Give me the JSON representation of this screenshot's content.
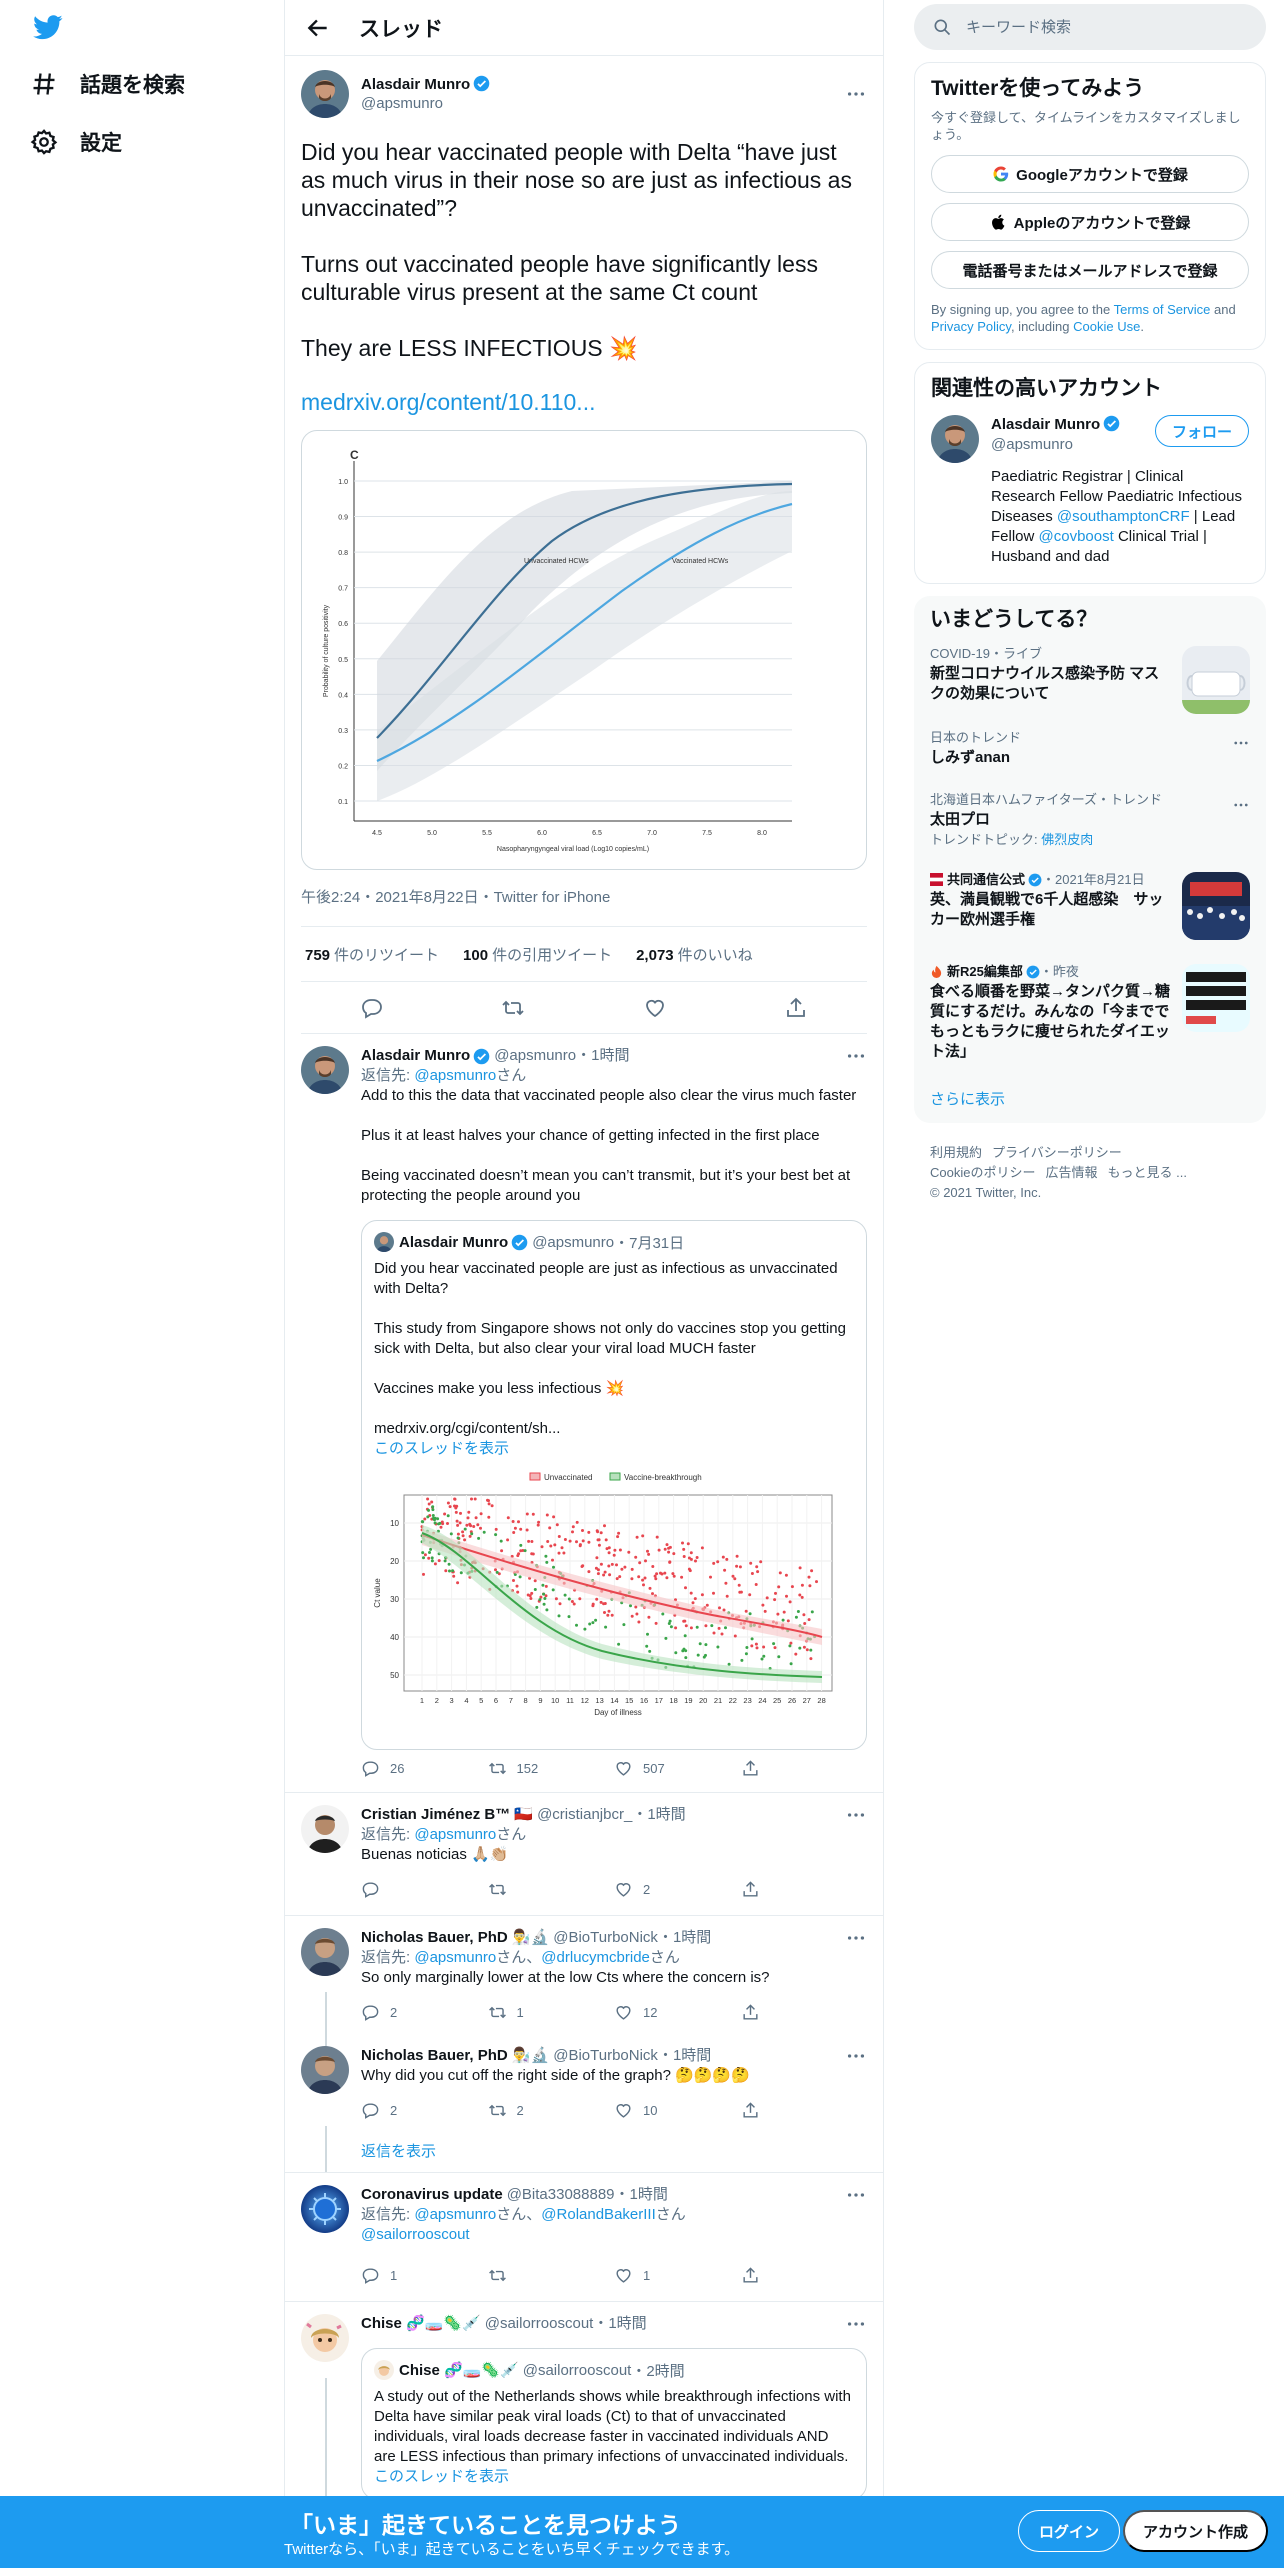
{
  "nav": {
    "explore": "話題を検索",
    "settings": "設定"
  },
  "header": {
    "title": "スレッド"
  },
  "focal": {
    "name": "Alasdair Munro",
    "handle": "@apsmunro",
    "text1": "Did you hear vaccinated people with Delta “have just as much virus in their nose so are just as infectious as unvaccinated”?",
    "text2": "Turns out vaccinated people have significantly less culturable virus present at the same Ct count",
    "text3": "They are LESS INFECTIOUS 💥",
    "link": "medrxiv.org/content/10.110...",
    "meta": "午後2:24・2021年8月22日・Twitter for iPhone",
    "retweets_count": "759",
    "retweets_label": "件のリツイート",
    "quotes_count": "100",
    "quotes_label": "件の引用ツイート",
    "likes_count": "2,073",
    "likes_label": "件のいいね"
  },
  "chart_data": [
    {
      "type": "line",
      "panel_label": "C",
      "xlabel": "Nasopharyngyngeal viral load (Log10 copies/mL)",
      "ylabel": "Probability of culture positivity",
      "x_ticks": [
        "4.5",
        "5.0",
        "5.5",
        "6.0",
        "6.5",
        "7.0",
        "7.5",
        "8.0"
      ],
      "y_ticks": [
        "0.1",
        "0.2",
        "0.3",
        "0.4",
        "0.5",
        "0.6",
        "0.7",
        "0.8",
        "0.9",
        "1.0"
      ],
      "series": [
        {
          "name": "Unvaccinated HCWs"
        },
        {
          "name": "Vaccinated HCWs"
        }
      ]
    },
    {
      "type": "scatter",
      "ylabel": "Ct value",
      "xlabel": "Day of illness",
      "y_ticks": [
        "10",
        "20",
        "30",
        "40",
        "50"
      ],
      "x_ticks": [
        "1",
        "2",
        "3",
        "4",
        "5",
        "6",
        "7",
        "8",
        "9",
        "10",
        "11",
        "12",
        "13",
        "14",
        "15",
        "16",
        "17",
        "18",
        "19",
        "20",
        "21",
        "22",
        "23",
        "24",
        "25",
        "26",
        "27",
        "28"
      ],
      "legend": [
        "Unvaccinated",
        "Vaccine-breakthrough"
      ],
      "colors": {
        "unvaccinated": "#e8464f",
        "breakthrough": "#3aa54a"
      }
    }
  ],
  "replies": [
    {
      "name": "Alasdair Munro",
      "handle": "@apsmunro",
      "time": "・1時間",
      "replyto_prefix": "返信先: ",
      "replyto_user": "@apsmunro",
      "replyto_suffix": "さん",
      "p1": "Add to this the data that vaccinated people also clear the virus much faster",
      "p2": "Plus it at least halves your chance of getting infected in the first place",
      "p3": "Being vaccinated doesn’t mean you can’t transmit, but it’s your best bet at protecting the people around you",
      "quote": {
        "name": "Alasdair Munro",
        "handle": "@apsmunro",
        "time": "・7月31日",
        "p1": "Did you hear vaccinated people are just as infectious as unvaccinated with Delta?",
        "p2": "This study from Singapore shows not only do vaccines stop you getting sick with Delta, but also clear your viral load MUCH faster",
        "p3": "Vaccines make you less infectious 💥",
        "p4": "medrxiv.org/cgi/content/sh...",
        "show": "このスレッドを表示"
      },
      "replies": "26",
      "retweets": "152",
      "likes": "507"
    },
    {
      "name": "Cristian Jiménez B™ 🇨🇱",
      "handle": "@cristianjbcr_",
      "time": "・1時間",
      "replyto_prefix": "返信先: ",
      "replyto_user": "@apsmunro",
      "replyto_suffix": "さん",
      "text": "Buenas noticias 🙏🏼👏🏼",
      "replies": "",
      "retweets": "",
      "likes": "2"
    },
    {
      "name": "Nicholas Bauer, PhD 👨‍🔬🔬",
      "handle": "@BioTurboNick",
      "time": "・1時間",
      "replyto_prefix": "返信先: ",
      "replyto_user": "@apsmunro",
      "replyto_mid": "さん、",
      "replyto_user2": "@drlucymcbride",
      "replyto_suffix": "さん",
      "text": "So only marginally lower at the low Cts where the concern is?",
      "replies": "2",
      "retweets": "1",
      "likes": "12"
    },
    {
      "name": "Nicholas Bauer, PhD 👨‍🔬🔬",
      "handle": "@BioTurboNick",
      "time": "・1時間",
      "text": "Why did you cut off the right side of the graph? 🤔🤔🤔🤔",
      "replies": "2",
      "retweets": "2",
      "likes": "10",
      "show_replies": "返信を表示"
    },
    {
      "name": "Coronavirus update",
      "handle": "@Bita33088889",
      "time": "・1時間",
      "replyto_prefix": "返信先: ",
      "replyto_user": "@apsmunro",
      "replyto_mid": "さん、",
      "replyto_user2": "@RolandBakerIII",
      "replyto_suffix": "さん",
      "replyto_user3": "@sailorrooscout",
      "replies": "1",
      "retweets": "",
      "likes": "1"
    },
    {
      "name": "Chise 🧬🧫🦠💉",
      "handle": "@sailorrooscout",
      "time": "・1時間",
      "quote": {
        "name": "Chise 🧬🧫🦠💉",
        "handle": "@sailorrooscout",
        "time": "・2時間",
        "text": "A study out of the Netherlands shows while breakthrough infections with Delta have similar peak viral loads (Ct) to that of unvaccinated individuals, viral loads decrease faster in vaccinated individuals AND are LESS infectious than primary infections of unvaccinated individuals.",
        "show": "このスレッドを表示"
      }
    }
  ],
  "right": {
    "search_placeholder": "キーワード検索",
    "signup_title": "Twitterを使ってみよう",
    "signup_sub": "今すぐ登録して、タイムラインをカスタマイズしましょう。",
    "google_btn": "Googleアカウントで登録",
    "apple_btn": "Appleのアカウントで登録",
    "phone_btn": "電話番号またはメールアドレスで登録",
    "terms_a": "By signing up, you agree to the ",
    "terms_tos": "Terms of Service",
    "terms_b": " and ",
    "terms_pp": "Privacy Policy",
    "terms_c": ", including ",
    "terms_cookie": "Cookie Use",
    "terms_d": ".",
    "related_title": "関連性の高いアカウント",
    "related_name": "Alasdair Munro",
    "related_handle": "@apsmunro",
    "follow": "フォロー",
    "bio_a": "Paediatric Registrar | Clinical Research Fellow Paediatric Infectious Diseases ",
    "bio_l1": "@southamptonCRF",
    "bio_b": " | Lead Fellow ",
    "bio_l2": "@covboost",
    "bio_c": " Clinical Trial | Husband and dad",
    "trends_title": "いまどうしてる？",
    "trends": [
      {
        "ctx": "COVID-19・ライブ",
        "title": "新型コロナウイルス感染予防 マスクの効果について"
      },
      {
        "ctx": "日本のトレンド",
        "title": "しみずanan"
      },
      {
        "ctx": "北海道日本ハムファイターズ・トレンド",
        "title": "太田プロ",
        "topic_label": "トレンドトピック: ",
        "topic": "佛烈皮肉"
      },
      {
        "ctx": "共同通信公式",
        "ctx_time": "・2021年8月21日",
        "title": "英、満員観戦で6千人超感染　サッカー欧州選手権"
      },
      {
        "ctx": "新R25編集部",
        "ctx_time": "・昨夜",
        "title": "食べる順番を野菜→タンパク質→糖質にするだけ。みんなの「今まででもっともラクに痩せられたダイエット法」"
      }
    ],
    "trends_more": "さらに表示",
    "footer1": [
      "利用規約",
      "プライバシーポリシー"
    ],
    "footer2": [
      "Cookieのポリシー",
      "広告情報",
      "もっと見る ..."
    ],
    "copyright": "© 2021 Twitter, Inc."
  },
  "bottom": {
    "headline": "「いま」起きていることを見つけよう",
    "sub": "Twitterなら、「いま」起きていることをいち早くチェックできます。",
    "login": "ログイン",
    "signup": "アカウント作成"
  }
}
